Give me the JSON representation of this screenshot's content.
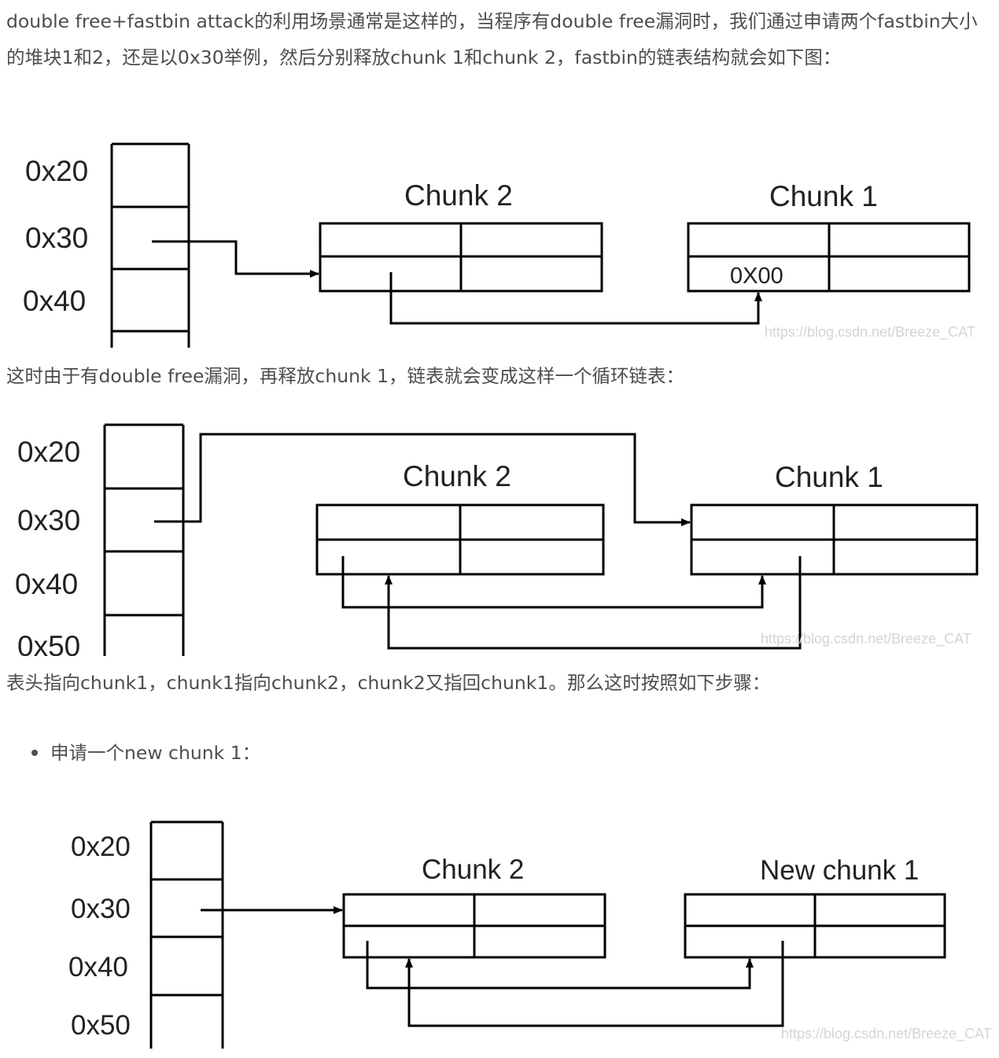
{
  "intro": {
    "text": "double free+fastbin attack的利用场景通常是这样的，当程序有double free漏洞时，我们通过申请两个fastbin大小的堆块1和2，还是以0x30举例，然后分别释放chunk 1和chunk 2，fastbin的链表结构就会如下图："
  },
  "figure1": {
    "bins": [
      "0x20",
      "0x30",
      "0x40"
    ],
    "chunk_a_title": "Chunk 2",
    "chunk_b_title": "Chunk 1",
    "null_value": "0X00",
    "watermark": "https://blog.csdn.net/Breeze_CAT"
  },
  "para2": {
    "text": "这时由于有double free漏洞，再释放chunk 1，链表就会变成这样一个循环链表："
  },
  "figure2": {
    "bins": [
      "0x20",
      "0x30",
      "0x40",
      "0x50"
    ],
    "chunk_a_title": "Chunk 2",
    "chunk_b_title": "Chunk 1",
    "watermark": "https://blog.csdn.net/Breeze_CAT"
  },
  "para3": {
    "text": "表头指向chunk1，chunk1指向chunk2，chunk2又指回chunk1。那么这时按照如下步骤："
  },
  "step1": {
    "text": "申请一个new chunk 1："
  },
  "figure3": {
    "bins": [
      "0x20",
      "0x30",
      "0x40",
      "0x50"
    ],
    "chunk_a_title": "Chunk 2",
    "chunk_b_title": "New chunk 1",
    "watermark": "https://blog.csdn.net/Breeze_CAT"
  },
  "colors": {
    "text": "#4d4d4d",
    "diagram_line": "#000000",
    "watermark": "#d4d4d4"
  }
}
